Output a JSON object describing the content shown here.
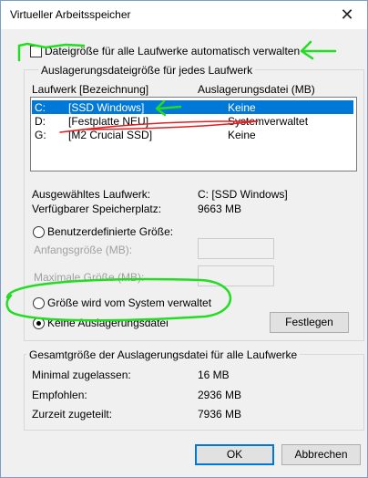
{
  "window": {
    "title": "Virtueller Arbeitsspeicher",
    "close_glyph": "✕"
  },
  "auto_manage": {
    "label": "Dateigröße für alle Laufwerke automatisch verwalten",
    "checked": false
  },
  "per_drive": {
    "group_title": "Auslagerungsdateigröße für jedes Laufwerk",
    "columns": [
      "Laufwerk [Bezeichnung]",
      "Auslagerungsdatei (MB)"
    ],
    "drives": [
      {
        "letter": "C:",
        "label": "[SSD Windows]",
        "paging": "Keine",
        "selected": true
      },
      {
        "letter": "D:",
        "label": "[Festplatte NEU]",
        "paging": "Systemverwaltet",
        "selected": false
      },
      {
        "letter": "G:",
        "label": "[M2 Crucial SSD]",
        "paging": "Keine",
        "selected": false
      }
    ],
    "selected_drive_label": "Ausgewähltes Laufwerk:",
    "selected_drive_value": "C:  [SSD Windows]",
    "free_space_label": "Verfügbarer Speicherplatz:",
    "free_space_value": "9663 MB",
    "custom_size_label": "Benutzerdefinierte Größe:",
    "initial_size_label": "Anfangsgröße (MB):",
    "max_size_label": "Maximale Größe (MB):",
    "initial_size_value": "",
    "max_size_value": "",
    "system_managed_label": "Größe wird vom System verwaltet",
    "no_paging_label": "Keine Auslagerungsdatei",
    "selected_option": "no_paging",
    "set_button": "Festlegen"
  },
  "totals": {
    "group_title": "Gesamtgröße der Auslagerungsdatei für alle Laufwerke",
    "min_label": "Minimal zugelassen:",
    "min_value": "16 MB",
    "recommended_label": "Empfohlen:",
    "recommended_value": "2936 MB",
    "allocated_label": "Zurzeit zugeteilt:",
    "allocated_value": "7936 MB"
  },
  "buttons": {
    "ok": "OK",
    "cancel": "Abbrechen"
  },
  "colors": {
    "selection": "#0078d7",
    "annotation_green": "#22dd22",
    "annotation_red": "#e02020"
  }
}
